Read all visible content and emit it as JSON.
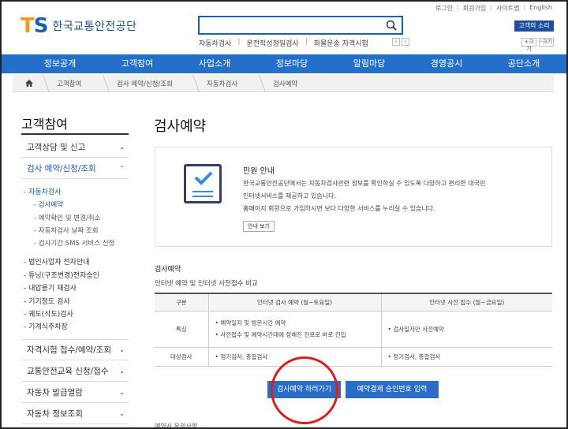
{
  "header": {
    "logo_letters": {
      "t": "T",
      "s": "S"
    },
    "logo_name": "한국교통안전공단",
    "search_placeholder": "",
    "quick_links": [
      "자동차검사",
      "운전적성정밀검사",
      "화물운송 자격시험"
    ],
    "util_links": [
      "로그인",
      "회원가입",
      "사이트맵",
      "English"
    ],
    "voice_button": "고객의 소리",
    "zoom_in": "+크기",
    "zoom_out": "-크기",
    "arrow_prev": "‹",
    "arrow_next": "›"
  },
  "nav": [
    "정보공개",
    "고객참여",
    "사업소개",
    "정보마당",
    "알림마당",
    "경영공시",
    "공단소개"
  ],
  "breadcrumb": [
    "고객참여",
    "검사 예약/신청/조회",
    "자동차검사",
    "검사예약"
  ],
  "sidebar": {
    "title": "고객참여",
    "items_top": [
      {
        "label": "고객상담 및 신고"
      },
      {
        "label": "검사 예약/신청/조회"
      }
    ],
    "sub_active": "자동차검사",
    "subsub": [
      "검사예약",
      "예약확인 및 변경/취소",
      "자동차검사 날짜 조회",
      "검사기간 SMS 서비스 신청"
    ],
    "subs_more": [
      "법인사업자 전자안내",
      "튜닝(구조변경)전자승인",
      "내압용기 재검사",
      "기기정도 검사",
      "궤도(삭도)검사",
      "기계식주차장"
    ],
    "items_bottom": [
      {
        "label": "자격시험 접수/예약/조회"
      },
      {
        "label": "교통안전교육 신청/접수"
      },
      {
        "label": "자동차 발급열람"
      },
      {
        "label": "자동차 정보조회"
      }
    ],
    "chevron": "⌄"
  },
  "main": {
    "title": "검사예약",
    "info": {
      "title": "민원 안내",
      "lines": [
        "한국교통안전공단에서는 자동차검사관련 정보를 확인하실 수 있도록 다양하고 편리한 대국민",
        "인터넷서비스를 제공하고 있습니다.",
        "홈페이지 회원으로 가입하시면 보다 다양한 서비스를 누리실 수 있습니다."
      ],
      "button": "안내 보기"
    },
    "section_title": "검사예약",
    "section_sub": "인터넷 예약 및 인터넷 사전접수 비교",
    "table": {
      "headers": [
        "구분",
        "인터넷 검사 예약 (월~토요일)",
        "인터넷 사전 접수 (월~금요일)"
      ],
      "rows": [
        {
          "label": "특징",
          "col1": [
            "예약일자 및 방문시간 예약",
            "사전접수 및 예약시간대에 정해진 진로로 바로 진입"
          ],
          "col2": [
            "검사일자만 사전예약"
          ]
        },
        {
          "label": "대상검사",
          "col1": [
            "정기검사, 종합검사"
          ],
          "col2": [
            "정기검사, 종합검사"
          ]
        }
      ]
    },
    "buttons": {
      "reserve": "검사예약 하러가기",
      "approval": "예약결제 승인번호 입력"
    },
    "cut_text": "예약시 유의사항"
  },
  "colors": {
    "brand_blue": "#2470c9",
    "logo_orange": "#f39a1e",
    "highlight_red": "#d92020"
  }
}
